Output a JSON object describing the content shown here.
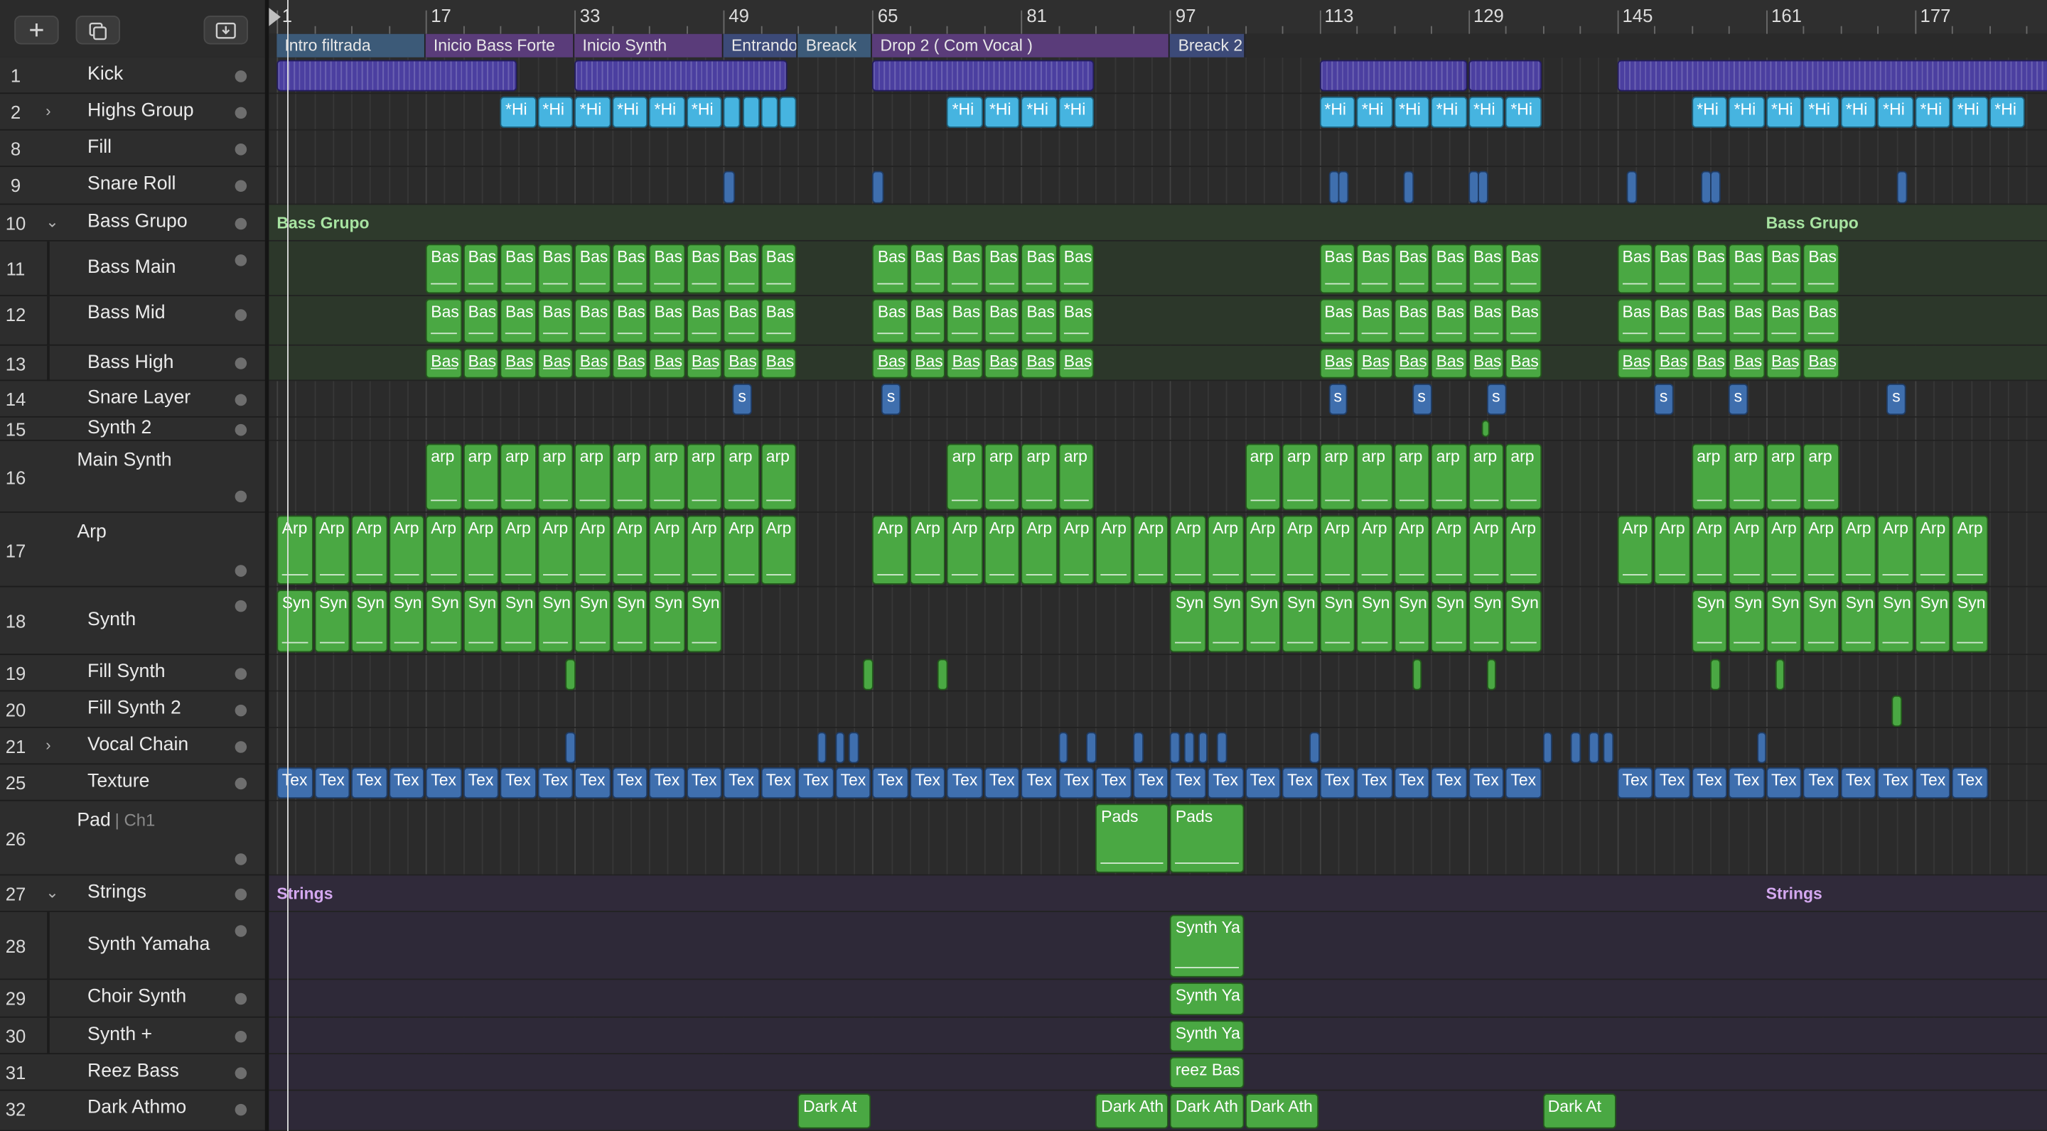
{
  "toolbar": {
    "add_icon": "plus-icon",
    "duplicate_icon": "duplicate-icon",
    "download_icon": "download-tray-icon"
  },
  "ruler": {
    "bars": [
      "1",
      "17",
      "33",
      "49",
      "65",
      "81",
      "97",
      "113",
      "129",
      "145",
      "161",
      "177"
    ]
  },
  "markers": [
    {
      "label": "Intro filtrada",
      "bar": 1,
      "end": 17,
      "color": "#3c5a78"
    },
    {
      "label": "Inicio Bass Forte",
      "bar": 17,
      "end": 33,
      "color": "#5a3c7a"
    },
    {
      "label": "Inicio Synth",
      "bar": 33,
      "end": 49,
      "color": "#5a3c7a"
    },
    {
      "label": "Entrando",
      "bar": 49,
      "end": 57,
      "color": "#3c4a78"
    },
    {
      "label": "Breack",
      "bar": 57,
      "end": 65,
      "color": "#3c5a78"
    },
    {
      "label": "Drop 2 ( Com Vocal )",
      "bar": 65,
      "end": 97,
      "color": "#5a3c7a"
    },
    {
      "label": "Breack 2",
      "bar": 97,
      "end": 105,
      "color": "#3c4a78"
    }
  ],
  "tracks": [
    {
      "num": "1",
      "name": "Kick",
      "disclosure": ""
    },
    {
      "num": "2",
      "name": "Highs Group",
      "disclosure": "›"
    },
    {
      "num": "8",
      "name": "Fill",
      "disclosure": ""
    },
    {
      "num": "9",
      "name": "Snare Roll",
      "disclosure": ""
    },
    {
      "num": "10",
      "name": "Bass Grupo",
      "disclosure": "⌄"
    },
    {
      "num": "11",
      "name": "Bass Main",
      "disclosure": ""
    },
    {
      "num": "12",
      "name": "Bass Mid",
      "disclosure": ""
    },
    {
      "num": "13",
      "name": "Bass High",
      "disclosure": ""
    },
    {
      "num": "14",
      "name": "Snare Layer",
      "disclosure": ""
    },
    {
      "num": "15",
      "name": "Synth 2",
      "disclosure": ""
    },
    {
      "num": "16",
      "name": "Main Synth",
      "disclosure": ""
    },
    {
      "num": "17",
      "name": "Arp",
      "disclosure": ""
    },
    {
      "num": "18",
      "name": "Synth",
      "disclosure": ""
    },
    {
      "num": "19",
      "name": "Fill Synth",
      "disclosure": ""
    },
    {
      "num": "20",
      "name": "Fill Synth 2",
      "disclosure": ""
    },
    {
      "num": "21",
      "name": "Vocal Chain",
      "disclosure": "›"
    },
    {
      "num": "25",
      "name": "Texture",
      "disclosure": ""
    },
    {
      "num": "26",
      "name": "Pad",
      "sub": "| Ch1",
      "disclosure": ""
    },
    {
      "num": "27",
      "name": "Strings",
      "disclosure": "⌄"
    },
    {
      "num": "28",
      "name": "Synth Yamaha",
      "disclosure": ""
    },
    {
      "num": "29",
      "name": "Choir Synth",
      "disclosure": ""
    },
    {
      "num": "30",
      "name": "Synth +",
      "disclosure": ""
    },
    {
      "num": "31",
      "name": "Reez Bass",
      "disclosure": ""
    },
    {
      "num": "32",
      "name": "Dark Athmo",
      "disclosure": ""
    }
  ],
  "group_labels": {
    "bass_grupo": "Bass Grupo",
    "strings": "Strings"
  },
  "region_labels": {
    "highs": "*Hi",
    "bass": "Bas",
    "bass_short": "Ba",
    "snare": "s",
    "arp_lower": "arp",
    "arp": "Arp",
    "synth": "Syn",
    "synth_short": "Sy",
    "texture": "Tex",
    "pads": "Pads",
    "synth_yamaha": "Synth Ya",
    "reez": "reez Bas",
    "dark": "Dark At",
    "dark_long": "Dark Ath"
  }
}
